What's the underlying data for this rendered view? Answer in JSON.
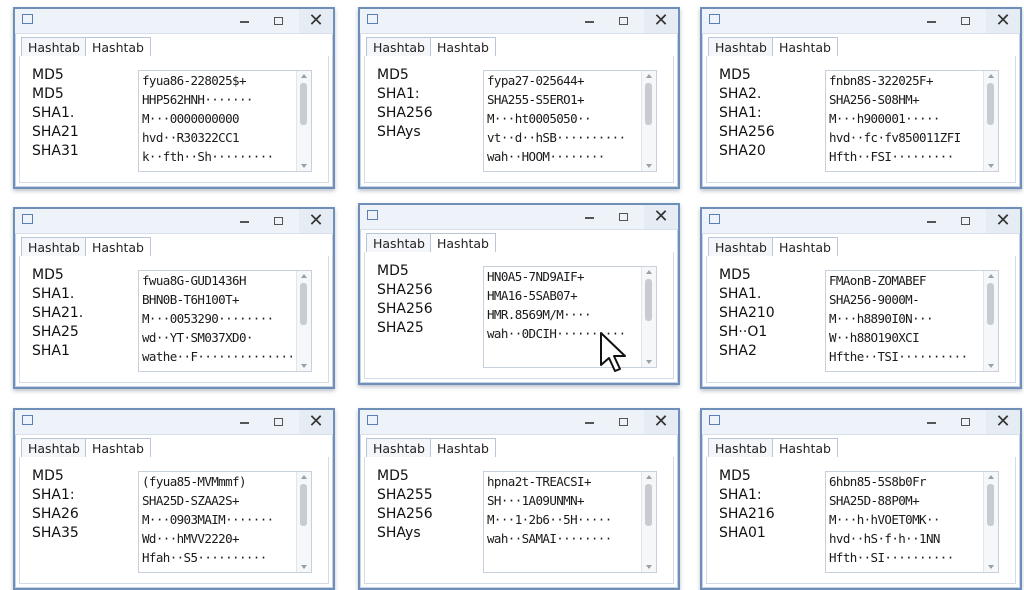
{
  "tabs": [
    "Hashtab",
    "Hashtab"
  ],
  "windows": [
    {
      "labels": [
        "MD5",
        "MD5",
        "SHA1.",
        "SHA21",
        "SHA31"
      ],
      "values": [
        "fyua86-228025$+",
        "HHP562HNH·······",
        "M···0000000000",
        "hvd··R30322CC1",
        "k··fth··Sh·········"
      ]
    },
    {
      "labels": [
        "MD5",
        "SHA1:",
        "SHA256",
        "SHAys"
      ],
      "values": [
        "fypa27-025644+",
        "SHA255-S5ERO1+",
        "M···ht0005050··",
        "vt··d··hSB··········",
        "wah··HOOM········"
      ]
    },
    {
      "labels": [
        "MD5",
        "SHA2.",
        "SHA1:",
        "SHA256",
        "SHA20"
      ],
      "values": [
        "fnbn8S-322025F+",
        "SHA256-S08HM+",
        "M···h900001·····",
        "hvd··fc·fv850011ZFI",
        "Hfth··FSI·········"
      ]
    },
    {
      "labels": [
        "MD5",
        "SHA1.",
        "SHA21.",
        "SHA25",
        "SHA1"
      ],
      "values": [
        "fwua8G-GUD1436H",
        "BHN0B-T6H100T+",
        "M···0053290········",
        "wd··YT·SM037XD0·",
        "wathe··F··············"
      ]
    },
    {
      "labels": [
        "MD5",
        "SHA256",
        "SHA256",
        "SHA25"
      ],
      "values": [
        "HN0A5-7ND9AIF+",
        "HMA16-5SAB07+",
        "HMR.8569M/M····",
        "wah··0DCIH··········"
      ]
    },
    {
      "labels": [
        "MD5",
        "SHA1.",
        "SHA210",
        "SH··O1",
        "SHA2"
      ],
      "values": [
        "FMAonB-ZOMABEF",
        "SHA256-9000M-",
        "M···h8890I0N···",
        "W··h88O190XCI",
        "Hfthe··TSI··········"
      ]
    },
    {
      "labels": [
        "MD5",
        "SHA1:",
        "SHA26",
        "SHA35"
      ],
      "values": [
        "(fyua85-MVMmmf)",
        "SHA25D-SZAA2S+",
        "M···0903MAIM·······",
        "Wd···hMVV2220+",
        "Hfah··S5··········"
      ]
    },
    {
      "labels": [
        "MD5",
        "SHA255",
        "SHA256",
        "SHAys"
      ],
      "values": [
        "hpna2t-TREACSI+",
        "SH···1A09UNMN+",
        "M···1·2b6··5H·····",
        "wah··SAMAI········"
      ]
    },
    {
      "labels": [
        "MD5",
        "SHA1:",
        "SHA216",
        "SHA01"
      ],
      "values": [
        "6hbn85-5S8b0Fr",
        "SHA25D-88P0M+",
        "M···h·hVOET0MK··",
        "hvd··hS·f·h··1NN",
        "Hfth··SI··········"
      ]
    }
  ],
  "icons": {
    "system": "window-icon",
    "minimize": "minimize-icon",
    "maximize": "maximize-icon",
    "close": "close-icon",
    "cursor": "mouse-pointer-icon"
  },
  "colors": {
    "frame": "#6f8fb8",
    "titlebar": "#eef3f9",
    "accent": "#4a7ec2"
  }
}
